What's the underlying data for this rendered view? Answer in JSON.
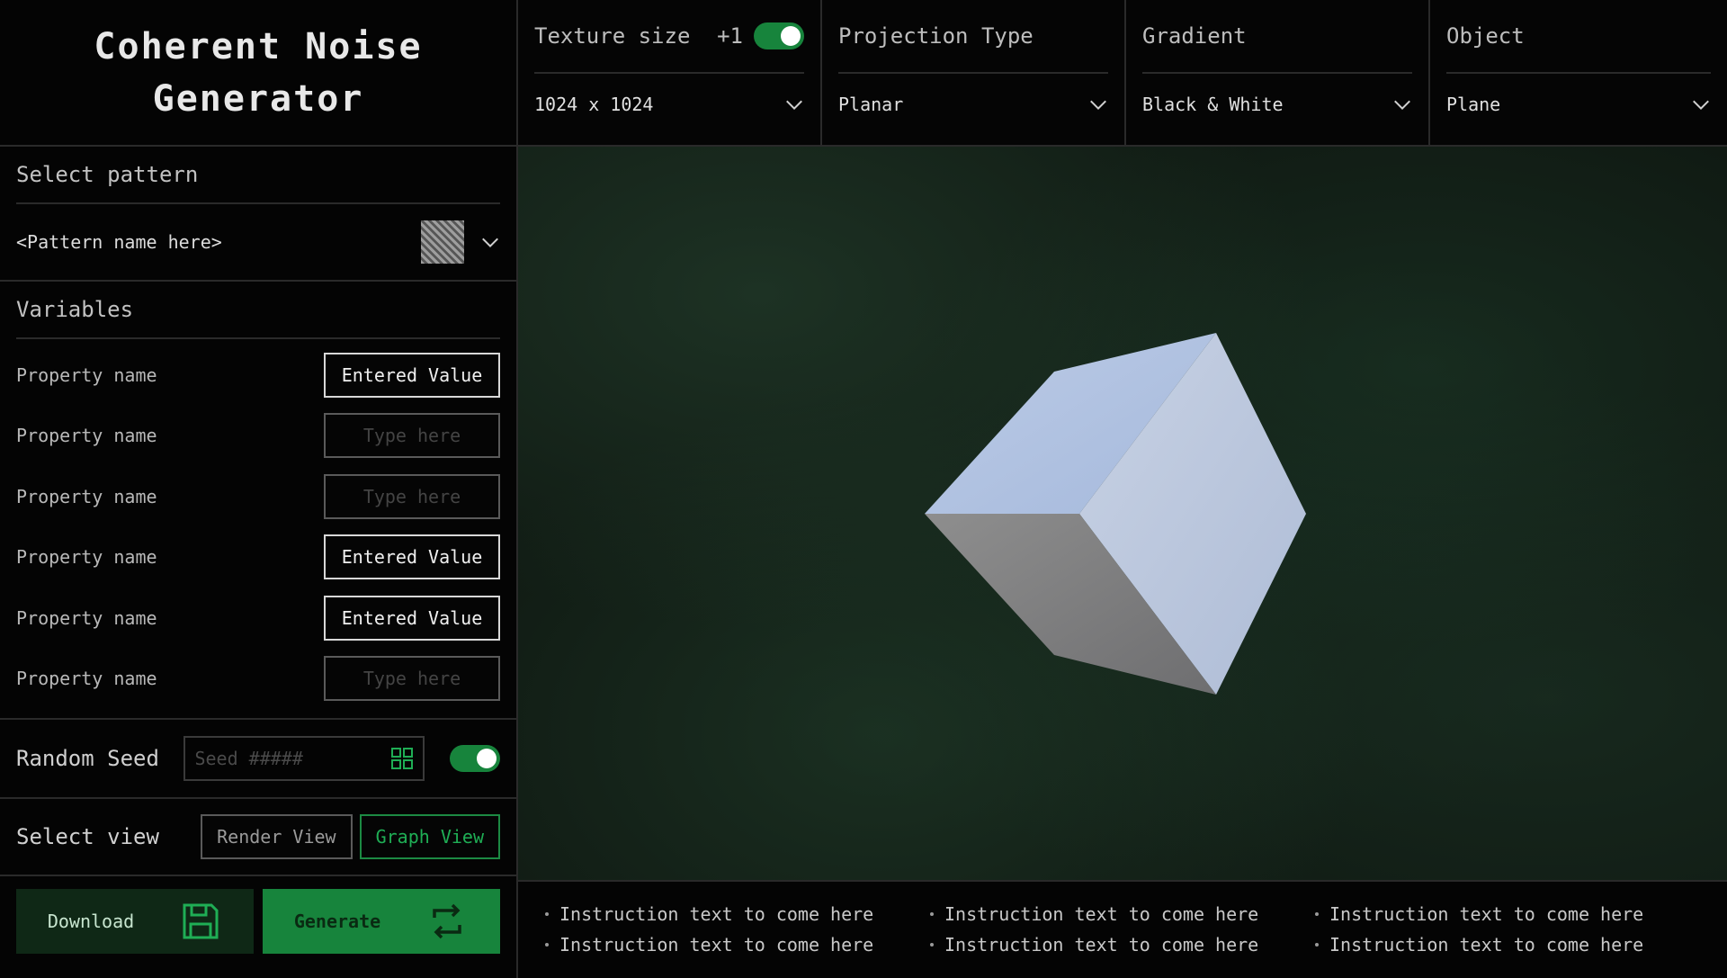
{
  "app": {
    "title": "Coherent Noise\nGenerator"
  },
  "topbar": {
    "texture": {
      "label": "Texture size",
      "badge": "+1",
      "value": "1024 x 1024"
    },
    "projection": {
      "label": "Projection Type",
      "value": "Planar"
    },
    "gradient": {
      "label": "Gradient",
      "value": "Black & White"
    },
    "object": {
      "label": "Object",
      "value": "Plane"
    }
  },
  "sidebar": {
    "pattern": {
      "label": "Select pattern",
      "value": "<Pattern name here>"
    },
    "variables": {
      "label": "Variables",
      "rows": [
        {
          "label": "Property name",
          "value": "Entered Value",
          "placeholder": "Type here"
        },
        {
          "label": "Property name",
          "value": "",
          "placeholder": "Type here"
        },
        {
          "label": "Property name",
          "value": "",
          "placeholder": "Type here"
        },
        {
          "label": "Property name",
          "value": "Entered Value",
          "placeholder": "Type here"
        },
        {
          "label": "Property name",
          "value": "Entered Value",
          "placeholder": "Type here"
        },
        {
          "label": "Property name",
          "value": "",
          "placeholder": "Type here"
        }
      ]
    },
    "seed": {
      "label": "Random Seed",
      "placeholder": "Seed #####"
    },
    "view": {
      "label": "Select view",
      "render_label": "Render View",
      "graph_label": "Graph View",
      "active": "graph"
    },
    "actions": {
      "download_label": "Download",
      "generate_label": "Generate"
    }
  },
  "footer": {
    "columns": [
      [
        "Instruction text to come here",
        "Instruction text to come here"
      ],
      [
        "Instruction text to come here",
        "Instruction text to come here"
      ],
      [
        "Instruction text to come here",
        "Instruction text to come here"
      ]
    ]
  },
  "colors": {
    "accent": "#17843c",
    "accent_text": "#1fae55",
    "background": "#000000"
  },
  "icons": {
    "chevron": "chevron-down-icon",
    "seed": "grid-icon",
    "download": "save-icon",
    "generate": "refresh-icon"
  }
}
